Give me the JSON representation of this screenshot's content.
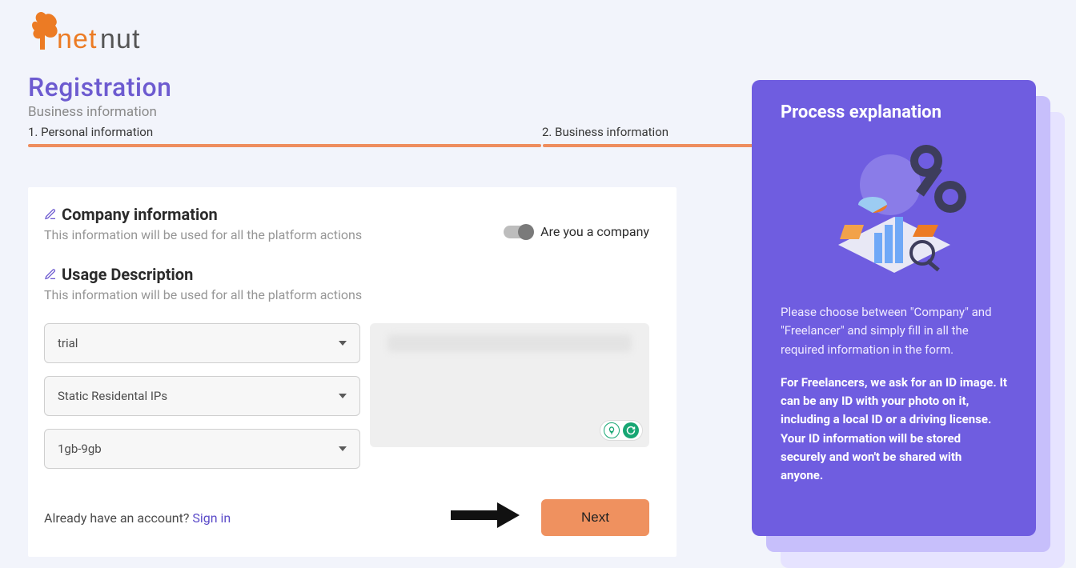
{
  "brand": {
    "name": "netnut"
  },
  "header": {
    "title": "Registration",
    "subtitle": "Business information"
  },
  "steps": {
    "step1": "1. Personal information",
    "step2": "2. Business information"
  },
  "company_section": {
    "title": "Company information",
    "desc": "This information will be used for all the platform actions",
    "toggle_label": "Are you a company"
  },
  "usage_section": {
    "title": "Usage Description",
    "desc": "This information will be used for all the platform actions"
  },
  "selects": {
    "use_case": "trial",
    "product": "Static Residental IPs",
    "bandwidth": "1gb-9gb"
  },
  "footer": {
    "already": "Already have an account? ",
    "signin": "Sign in",
    "next": "Next"
  },
  "side": {
    "title": "Process explanation",
    "p1": "Please choose between \"Company\" and \"Freelancer\" and simply fill in all the required information in the form.",
    "p2_bold": "For Freelancers, we ask for an ID image. It can be any ID with your photo on it, including a local ID or a driving license. Your ID information will be stored securely and won't be shared with anyone."
  },
  "colors": {
    "accent_purple": "#6d5bd0",
    "accent_orange": "#ee8d5e"
  }
}
